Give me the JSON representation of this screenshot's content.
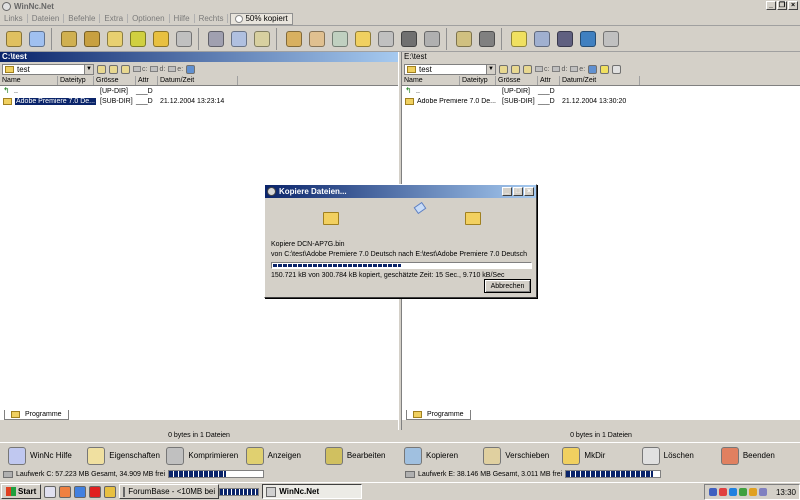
{
  "window": {
    "title": "WinNc.Net"
  },
  "menu": {
    "items": [
      "Links",
      "Dateien",
      "Befehle",
      "Extra",
      "Optionen",
      "Hilfe",
      "Rechts"
    ],
    "copy_status": "50% kopiert"
  },
  "toolbar": {
    "icons": [
      "copy-icon",
      "clipboard-icon",
      "archive-icon",
      "pack-icon",
      "unpack-icon",
      "edit-icon",
      "sticky-icon",
      "tools-icon",
      "printer-icon",
      "multi-rename-icon",
      "compare-icon",
      "package-icon",
      "sync-icon",
      "tree-icon",
      "folder-icon",
      "drive-icon",
      "ftp-icon",
      "speaker-icon",
      "media-icon",
      "camera-icon",
      "bulb-icon",
      "network-icon",
      "monitor-icon",
      "globe-icon",
      "terminal-icon"
    ],
    "colors": [
      "#e0c060",
      "#a0c0f0",
      "#d0b050",
      "#c8a040",
      "#e8d070",
      "#d0d040",
      "#e8c040",
      "#c0c0c0",
      "#a0a0b0",
      "#b0c0e0",
      "#d8d0a0",
      "#d8b060",
      "#e0c090",
      "#c0d0c0",
      "#f0d060",
      "#c0c0c0",
      "#707070",
      "#b0b0b0",
      "#d0c080",
      "#808080",
      "#f0e060",
      "#a0b0d0",
      "#606080",
      "#4080c0",
      "#c0c0c0"
    ]
  },
  "left_panel": {
    "header": "C:\\test",
    "path": "test",
    "drives": [
      "c:",
      "d:",
      "e:"
    ],
    "columns": [
      "Name",
      "Dateityp",
      "Grösse",
      "Attr",
      "Datum/Zeit"
    ],
    "rows": [
      {
        "name": "..",
        "size": "[UP-DIR]",
        "attr": "___D",
        "date": ""
      },
      {
        "name": "Adobe Premiere 7.0 De...",
        "size": "[SUB-DIR]",
        "attr": "___D",
        "date": "21.12.2004 13:23:14"
      }
    ],
    "tab": "Programme",
    "bytes": "0 bytes in 1 Dateien",
    "drive_status": "Laufwerk C: 57.223 MB Gesamt, 34.909 MB frei",
    "free_fraction": 0.61
  },
  "right_panel": {
    "header": "E:\\test",
    "path": "test",
    "drives": [
      "c:",
      "d:",
      "e:"
    ],
    "columns": [
      "Name",
      "Dateityp",
      "Grösse",
      "Attr",
      "Datum/Zeit"
    ],
    "rows": [
      {
        "name": "..",
        "size": "[UP-DIR]",
        "attr": "___D",
        "date": ""
      },
      {
        "name": "Adobe Premiere 7.0 De...",
        "size": "[SUB-DIR]",
        "attr": "___D",
        "date": "21.12.2004 13:30:20"
      }
    ],
    "tab": "Programme",
    "bytes": "0 bytes in 1 Dateien",
    "drive_status": "Laufwerk E: 38.146 MB Gesamt, 3.011 MB frei",
    "free_fraction": 0.92
  },
  "fkeys": [
    "WinNc Hilfe",
    "Eigenschaften",
    "Komprimieren",
    "Anzeigen",
    "Bearbeiten",
    "Kopieren",
    "Verschieben",
    "MkDir",
    "Löschen",
    "Beenden"
  ],
  "dialog": {
    "title": "Kopiere Dateien...",
    "file_line": "Kopiere DCN-AP7G.bin",
    "path_line": "von C:\\test\\Adobe Premiere 7.0 Deutsch nach E:\\test\\Adobe Premiere 7.0 Deutsch",
    "progress": 0.5,
    "stats": "150.721 kB von 300.784 kB kopiert, geschätzte Zeit: 15 Sec., 9.710 kB/Sec",
    "cancel": "Abbrechen"
  },
  "taskbar": {
    "start": "Start",
    "tasks": [
      "ForumBase - <10MB bei ...",
      "WinNc.Net"
    ],
    "clock": "13:30"
  }
}
